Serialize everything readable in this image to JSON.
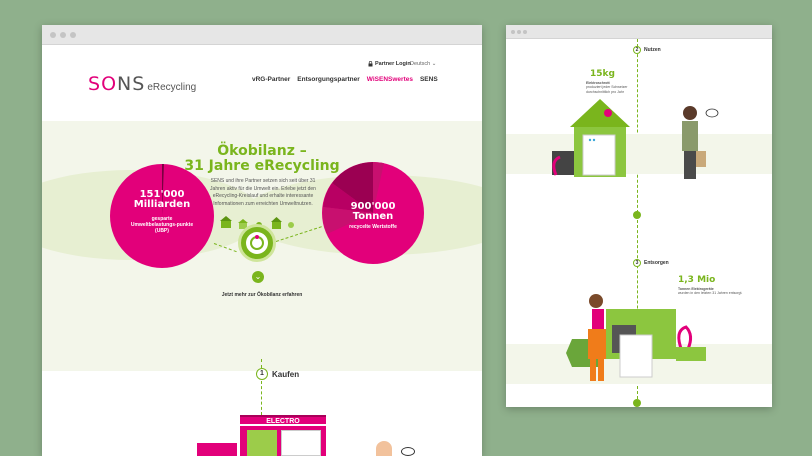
{
  "left_window": {
    "logo": {
      "brand_prefix": "S",
      "brand_mid": "O",
      "brand_suffix": "NS",
      "sub": "eRecycling"
    },
    "header": {
      "partner_login": "Partner Login",
      "language": "Deutsch",
      "nav": [
        "vRG-Partner",
        "Entsorgungspartner",
        "WiSENSwertes",
        "SENS"
      ]
    },
    "hero": {
      "title_line1": "Ökobilanz –",
      "title_line2": "31 Jahre eRecycling",
      "text": "SENS und ihre Partner setzen sich seit über 31 Jahren aktiv für die Umwelt ein. Erlebe jetzt den eRecycling-Kreislauf und erhalte interessante Informationen zum erreichten Umweltnutzen.",
      "left_stat": {
        "value": "151'000",
        "unit": "Milliarden",
        "label": "gesparte Umweltbelastungs-punkte (UBP)"
      },
      "right_stat": {
        "value": "900'000",
        "unit": "Tonnen",
        "label": "recycelte Wertstoffe"
      },
      "more_link": "Jetzt mehr zur Ökobilanz erfahren"
    },
    "step": {
      "number": "1",
      "label": "Kaufen"
    },
    "store_sign": "ELECTRO"
  },
  "right_window": {
    "step2": {
      "number": "2",
      "label": "Nutzen"
    },
    "stat1": {
      "value": "15kg",
      "label": "Elektroschrott",
      "desc": "produziert jeder Schweizer durchschnittlich pro Jahr"
    },
    "step3": {
      "number": "3",
      "label": "Entsorgen"
    },
    "stat2": {
      "value": "1,3 Mio",
      "label": "Tonnen Elektrogeräte",
      "desc": "wurden in den letzten 31 Jahren entsorgt."
    }
  },
  "colors": {
    "brand_magenta": "#e2007a",
    "brand_green": "#7ab51d",
    "background": "#8fb08c"
  }
}
